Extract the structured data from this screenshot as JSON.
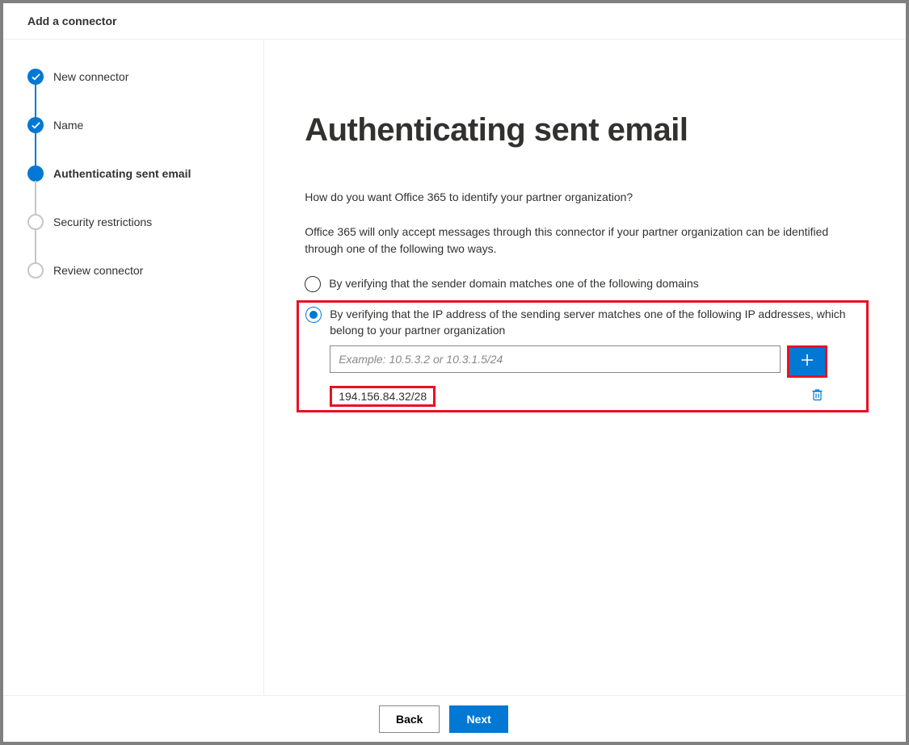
{
  "header": {
    "title": "Add a connector"
  },
  "wizard": {
    "steps": [
      {
        "label": "New connector",
        "state": "done"
      },
      {
        "label": "Name",
        "state": "done"
      },
      {
        "label": "Authenticating sent email",
        "state": "current"
      },
      {
        "label": "Security restrictions",
        "state": "pending"
      },
      {
        "label": "Review connector",
        "state": "pending"
      }
    ]
  },
  "main": {
    "title": "Authenticating sent email",
    "question": "How do you want Office 365 to identify your partner organization?",
    "explanation": "Office 365 will only accept messages through this connector if your partner organization can be identified through one of the following two ways.",
    "options": [
      {
        "label": "By verifying that the sender domain matches one of the following domains",
        "selected": false
      },
      {
        "label": "By verifying that the IP address of the sending server matches one of the following IP addresses, which belong to your partner organization",
        "selected": true
      }
    ],
    "ip_input": {
      "value": "",
      "placeholder": "Example: 10.5.3.2 or 10.3.1.5/24"
    },
    "ip_entries": [
      "194.156.84.32/28"
    ]
  },
  "footer": {
    "back_label": "Back",
    "next_label": "Next"
  }
}
